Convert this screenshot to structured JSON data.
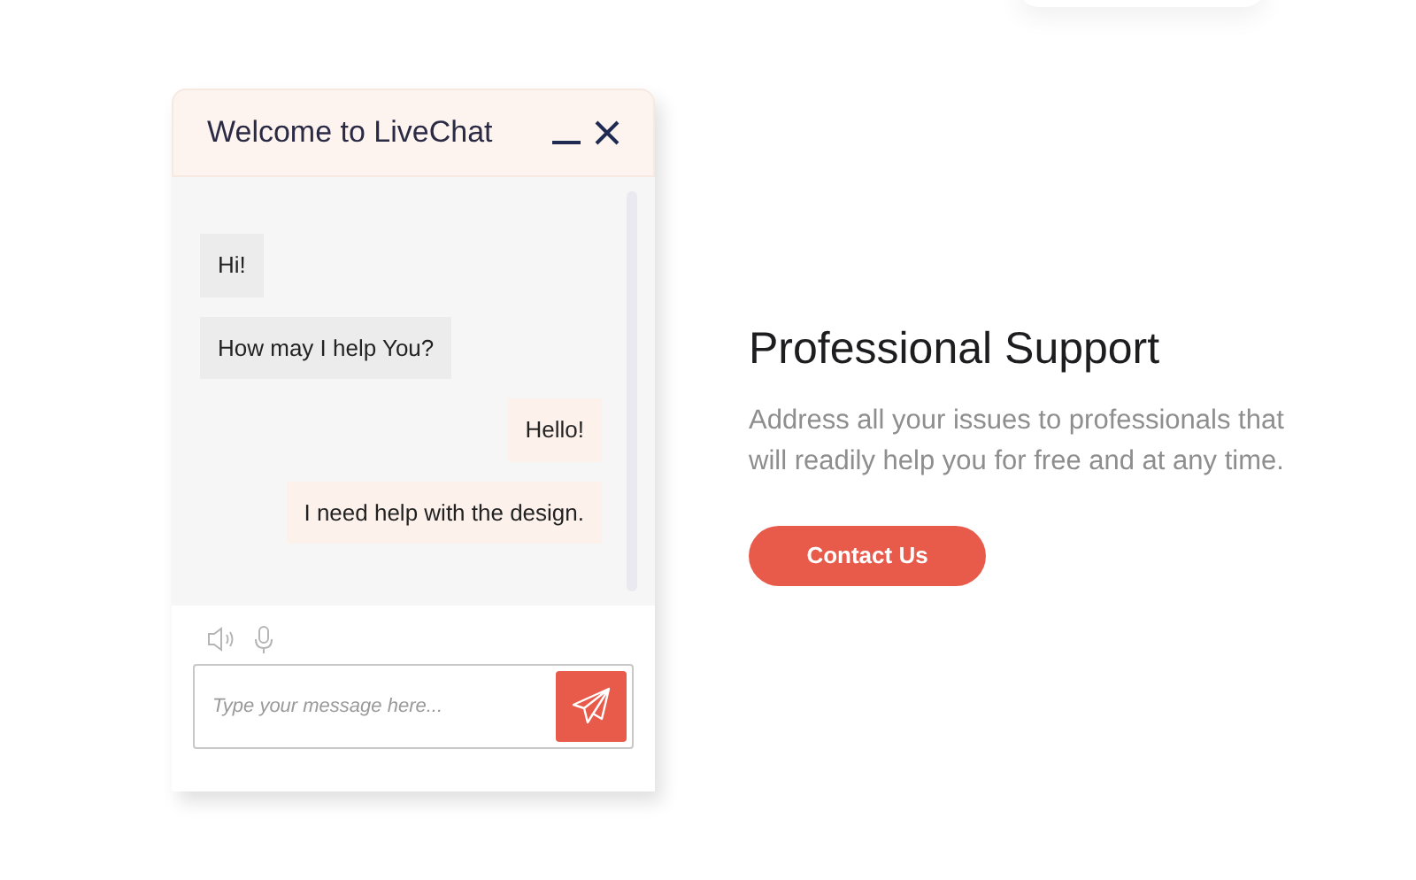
{
  "chat": {
    "title": "Welcome to LiveChat",
    "messages": [
      {
        "kind": "agent",
        "text": "Hi!"
      },
      {
        "kind": "agent",
        "text": "How may I help You?"
      },
      {
        "kind": "user",
        "text": "Hello!"
      },
      {
        "kind": "user",
        "text": "I need help with the design."
      }
    ],
    "input": {
      "placeholder": "Type your message here..."
    }
  },
  "feature": {
    "title": "Professional Support",
    "description": "Address all your issues to professionals that will readily help you for free and at any time.",
    "button": "Contact Us"
  }
}
